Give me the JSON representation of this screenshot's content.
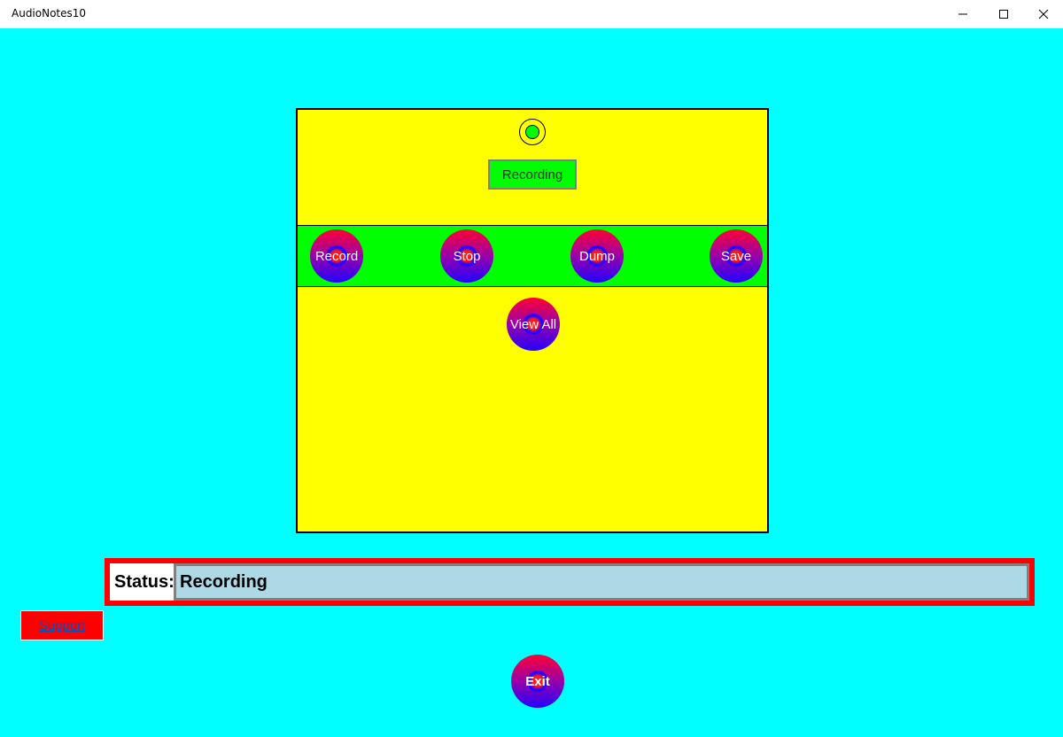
{
  "window": {
    "title": "AudioNotes10",
    "controls": {
      "minimize": "minimize-icon",
      "maximize": "maximize-icon",
      "close": "close-icon"
    }
  },
  "colors": {
    "background": "#00ffff",
    "panel": "#ffff00",
    "band": "#00ff00",
    "status_frame": "#ff0000",
    "status_value_bg": "#add8e6",
    "indicator": "#00ff00"
  },
  "main": {
    "mode_label": "Recording",
    "buttons": {
      "record": "Record",
      "stop": "Stop",
      "dump": "Dump",
      "save": "Save",
      "view_all": "View All"
    }
  },
  "status": {
    "label": "Status:",
    "value": "Recording"
  },
  "footer": {
    "support_link": "Support",
    "exit_button": "Exit"
  }
}
